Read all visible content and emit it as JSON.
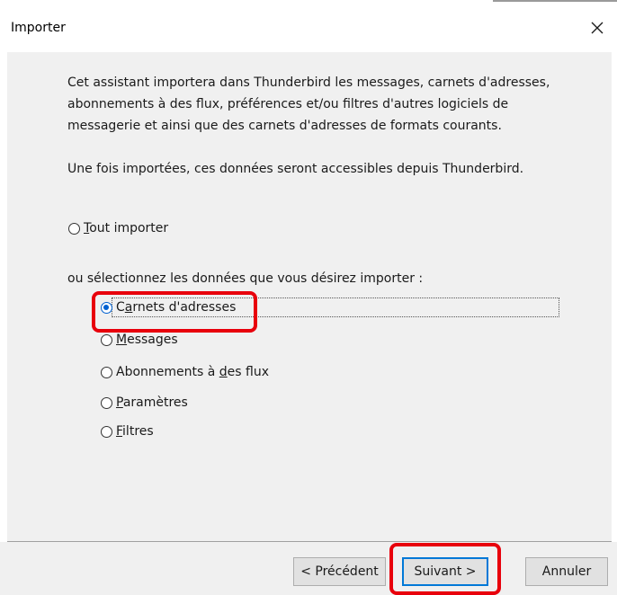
{
  "dialog": {
    "title": "Importer",
    "close_glyph": "✕"
  },
  "content": {
    "intro": "Cet assistant importera dans Thunderbird les messages, carnets d'adresses, abonnements à des flux, préférences et/ou filtres d'autres logiciels de messagerie et ainsi que des carnets d'adresses de formats courants.",
    "intro2": "Une fois importées, ces données seront accessibles depuis Thunderbird.",
    "import_all": {
      "accel": "T",
      "rest": "out importer",
      "checked": false
    },
    "section_label": "ou sélectionnez les données que vous désirez importer :",
    "options": [
      {
        "accel": "a",
        "before": "C",
        "after": "rnets d'adresses",
        "checked": true
      },
      {
        "accel": "M",
        "before": "",
        "after": "essages",
        "checked": false
      },
      {
        "accel": "d",
        "before": "Abonnements à ",
        "after": "es flux",
        "checked": false
      },
      {
        "accel": "P",
        "before": "",
        "after": "aramètres",
        "checked": false
      },
      {
        "accel": "F",
        "before": "",
        "after": "iltres",
        "checked": false
      }
    ]
  },
  "footer": {
    "back_label": "< Précédent",
    "next_label": "Suivant >",
    "cancel_label": "Annuler"
  },
  "colors": {
    "content_bg": "#f0f0f0",
    "highlight": "#e8000c",
    "radio_checked": "#0060d0",
    "button_bg": "#e1e1e1"
  }
}
